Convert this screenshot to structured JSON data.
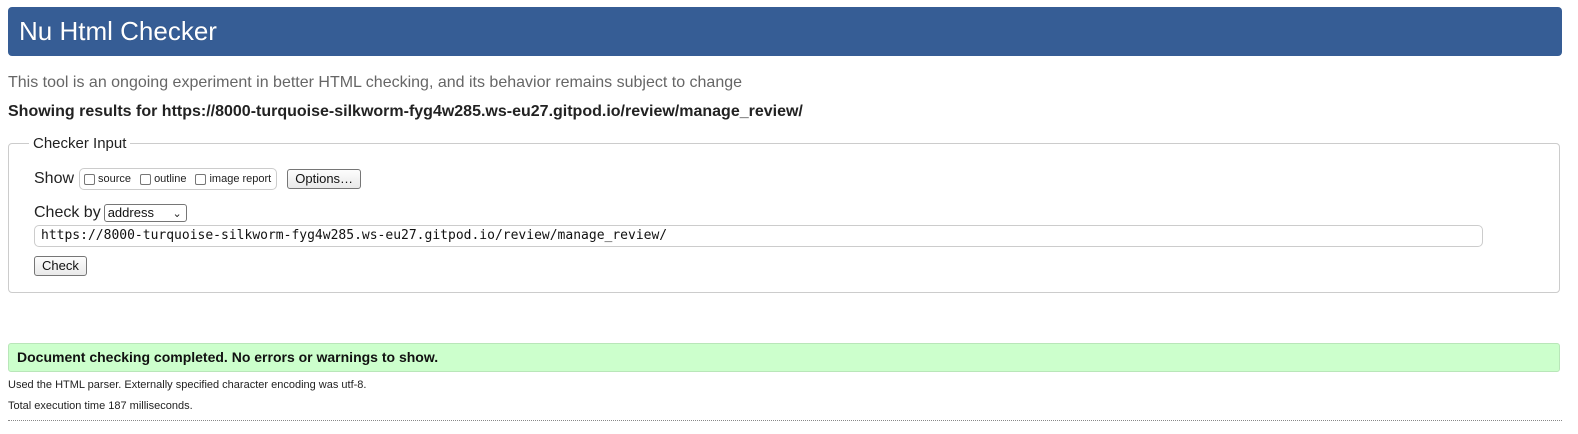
{
  "header": {
    "title": "Nu Html Checker",
    "background_color": "#365d95"
  },
  "subtitle": "This tool is an ongoing experiment in better HTML checking, and its behavior remains subject to change",
  "showing_results": "Showing results for https://8000-turquoise-silkworm-fyg4w285.ws-eu27.gitpod.io/review/manage_review/",
  "checker_input": {
    "legend": "Checker Input",
    "show_label": "Show",
    "show_options": [
      {
        "label": "source",
        "checked": false
      },
      {
        "label": "outline",
        "checked": false
      },
      {
        "label": "image report",
        "checked": false
      }
    ],
    "options_button": "Options…",
    "check_by_label": "Check by",
    "check_by_selected": "address",
    "url_value": "https://8000-turquoise-silkworm-fyg4w285.ws-eu27.gitpod.io/review/manage_review/",
    "check_button": "Check"
  },
  "result": {
    "message": "Document checking completed. No errors or warnings to show.",
    "background_color": "#ccffcc"
  },
  "footer": {
    "parser_info": "Used the HTML parser. Externally specified character encoding was utf-8.",
    "execution_time": "Total execution time 187 milliseconds."
  }
}
